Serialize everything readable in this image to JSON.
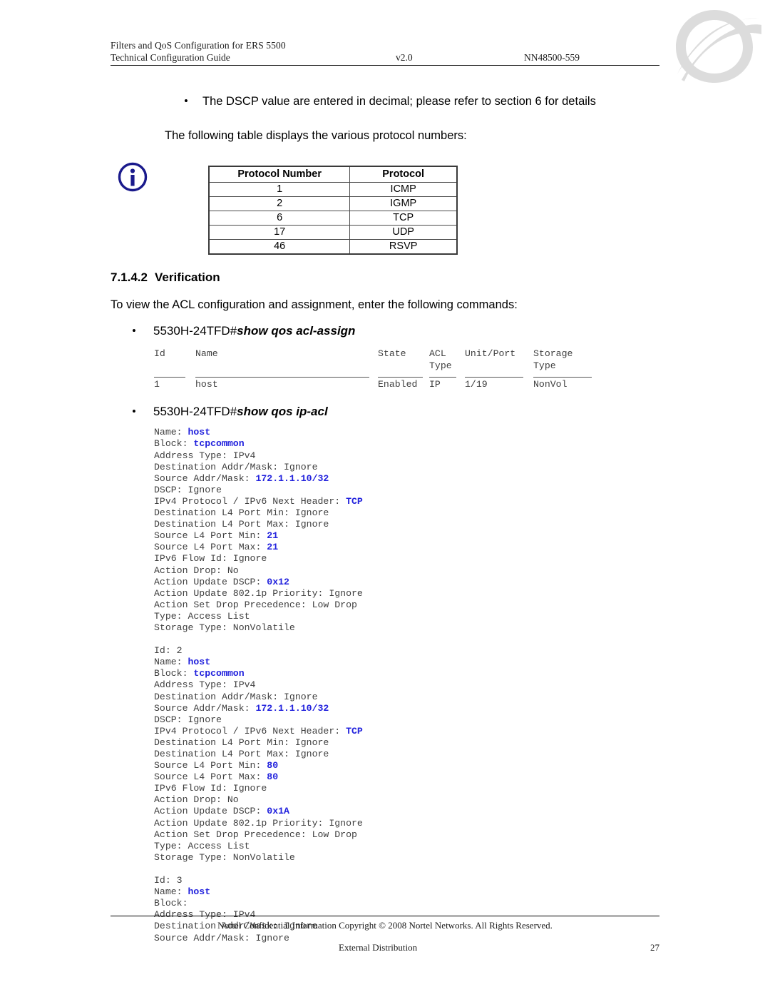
{
  "header": {
    "title_line1": "Filters and QoS Configuration for ERS 5500",
    "title_line2": "Technical Configuration Guide",
    "version": "v2.0",
    "doc_id": "NN48500-559",
    "logo_name": "nortel-globemark-logo"
  },
  "body": {
    "bullet_dscp": "The DSCP value are entered in decimal; please refer to section 6 for details",
    "bullet_glyph": "•",
    "info_note": "The following table displays the various protocol numbers:",
    "info_icon_name": "info-circle-icon"
  },
  "protocol_table": {
    "columns": [
      "Protocol Number",
      "Protocol"
    ],
    "rows": [
      [
        "1",
        "ICMP"
      ],
      [
        "2",
        "IGMP"
      ],
      [
        "6",
        "TCP"
      ],
      [
        "17",
        "UDP"
      ],
      [
        "46",
        "RSVP"
      ]
    ]
  },
  "section": {
    "number": "7.1.4.2",
    "title": "Verification",
    "intro": "To view the ACL configuration and assignment, enter the following commands:"
  },
  "commands": {
    "cmd1_prompt": "5530H-24TFD#",
    "cmd1_command": "show qos acl-assign",
    "cmd2_prompt": "5530H-24TFD#",
    "cmd2_command": "show qos ip-acl"
  },
  "acl_assign_output": {
    "header_row1": {
      "id": "Id",
      "name": "Name",
      "state": "State",
      "acl": "ACL",
      "unit_port": "Unit/Port",
      "storage": "Storage"
    },
    "header_row2": {
      "id": "",
      "name": "",
      "state": "",
      "acl": "Type",
      "unit_port": "",
      "storage": "Type"
    },
    "data_row": {
      "id": "1",
      "name": "host",
      "state": "Enabled",
      "acl": "IP",
      "unit_port": "1/19",
      "storage": "NonVol"
    }
  },
  "ip_acl_output": {
    "entries": [
      {
        "id_line": "",
        "lines": [
          {
            "label": "Name: ",
            "value": "host",
            "highlight": true
          },
          {
            "label": "Block: ",
            "value": "tcpcommon",
            "highlight": true
          },
          {
            "label": "Address Type: IPv4",
            "value": "",
            "highlight": false
          },
          {
            "label": "Destination Addr/Mask: Ignore",
            "value": "",
            "highlight": false
          },
          {
            "label": "Source Addr/Mask: ",
            "value": "172.1.1.10/32",
            "highlight": true
          },
          {
            "label": "DSCP: Ignore",
            "value": "",
            "highlight": false
          },
          {
            "label": "IPv4 Protocol / IPv6 Next Header: ",
            "value": "TCP",
            "highlight": true
          },
          {
            "label": "Destination L4 Port Min: Ignore",
            "value": "",
            "highlight": false
          },
          {
            "label": "Destination L4 Port Max: Ignore",
            "value": "",
            "highlight": false
          },
          {
            "label": "Source L4 Port Min: ",
            "value": "21",
            "highlight": true
          },
          {
            "label": "Source L4 Port Max: ",
            "value": "21",
            "highlight": true
          },
          {
            "label": "IPv6 Flow Id: Ignore",
            "value": "",
            "highlight": false
          },
          {
            "label": "Action Drop: No",
            "value": "",
            "highlight": false
          },
          {
            "label": "Action Update DSCP: ",
            "value": "0x12",
            "highlight": true
          },
          {
            "label": "Action Update 802.1p Priority: Ignore",
            "value": "",
            "highlight": false
          },
          {
            "label": "Action Set Drop Precedence: Low Drop",
            "value": "",
            "highlight": false
          },
          {
            "label": "Type: Access List",
            "value": "",
            "highlight": false
          },
          {
            "label": "Storage Type: NonVolatile",
            "value": "",
            "highlight": false
          }
        ]
      },
      {
        "id_line": "Id: 2",
        "lines": [
          {
            "label": "Name: ",
            "value": "host",
            "highlight": true
          },
          {
            "label": "Block: ",
            "value": "tcpcommon",
            "highlight": true
          },
          {
            "label": "Address Type: IPv4",
            "value": "",
            "highlight": false
          },
          {
            "label": "Destination Addr/Mask: Ignore",
            "value": "",
            "highlight": false
          },
          {
            "label": "Source Addr/Mask: ",
            "value": "172.1.1.10/32",
            "highlight": true
          },
          {
            "label": "DSCP: Ignore",
            "value": "",
            "highlight": false
          },
          {
            "label": "IPv4 Protocol / IPv6 Next Header: ",
            "value": "TCP",
            "highlight": true
          },
          {
            "label": "Destination L4 Port Min: Ignore",
            "value": "",
            "highlight": false
          },
          {
            "label": "Destination L4 Port Max: Ignore",
            "value": "",
            "highlight": false
          },
          {
            "label": "Source L4 Port Min: ",
            "value": "80",
            "highlight": true
          },
          {
            "label": "Source L4 Port Max: ",
            "value": "80",
            "highlight": true
          },
          {
            "label": "IPv6 Flow Id: Ignore",
            "value": "",
            "highlight": false
          },
          {
            "label": "Action Drop: No",
            "value": "",
            "highlight": false
          },
          {
            "label": "Action Update DSCP: ",
            "value": "0x1A",
            "highlight": true
          },
          {
            "label": "Action Update 802.1p Priority: Ignore",
            "value": "",
            "highlight": false
          },
          {
            "label": "Action Set Drop Precedence: Low Drop",
            "value": "",
            "highlight": false
          },
          {
            "label": "Type: Access List",
            "value": "",
            "highlight": false
          },
          {
            "label": "Storage Type: NonVolatile",
            "value": "",
            "highlight": false
          }
        ]
      },
      {
        "id_line": "Id: 3",
        "lines": [
          {
            "label": "Name: ",
            "value": "host",
            "highlight": true
          },
          {
            "label": "Block:",
            "value": "",
            "highlight": false
          },
          {
            "label": "Address Type: IPv4",
            "value": "",
            "highlight": false
          },
          {
            "label": "Destination Addr/Mask: Ignore",
            "value": "",
            "highlight": false
          },
          {
            "label": "Source Addr/Mask: Ignore",
            "value": "",
            "highlight": false
          }
        ]
      }
    ]
  },
  "footer": {
    "copyright": "Nortel Confidential Information   Copyright © 2008 Nortel Networks. All Rights Reserved.",
    "distribution": "External Distribution",
    "page_number": "27"
  },
  "colors": {
    "highlight_blue": "#2222dd",
    "cli_gray": "#3f3f3f",
    "info_icon_navy": "#1a1a8c",
    "logo_gray": "#dcdcdc"
  }
}
